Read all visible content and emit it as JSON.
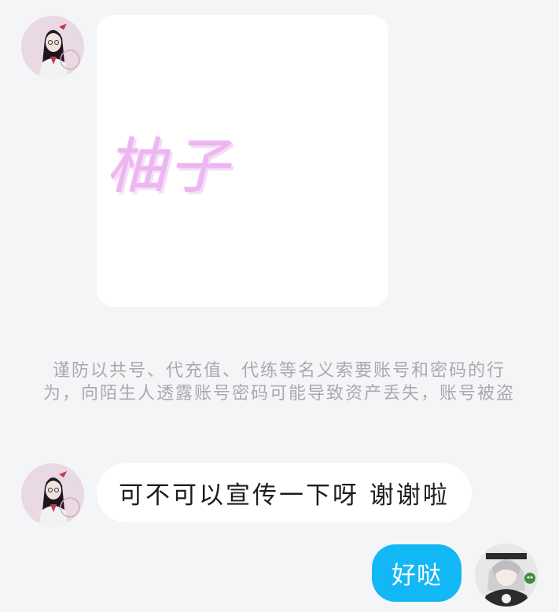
{
  "messages": [
    {
      "sender": "other",
      "type": "image",
      "image_text": "柚子"
    },
    {
      "type": "system_notice",
      "text": "谨防以共号、代充值、代练等名义索要账号和密码的行为，向陌生人透露账号密码可能导致资产丢失，账号被盗"
    },
    {
      "sender": "other",
      "type": "text",
      "text": "可不可以宣传一下呀 谢谢啦"
    },
    {
      "sender": "self",
      "type": "text",
      "text": "好哒"
    }
  ],
  "colors": {
    "background": "#f4f5f7",
    "incoming_bubble": "#ffffff",
    "outgoing_bubble": "#12b7f5",
    "notice_text": "#a9aaad",
    "image_text": "#ecb6f1"
  }
}
